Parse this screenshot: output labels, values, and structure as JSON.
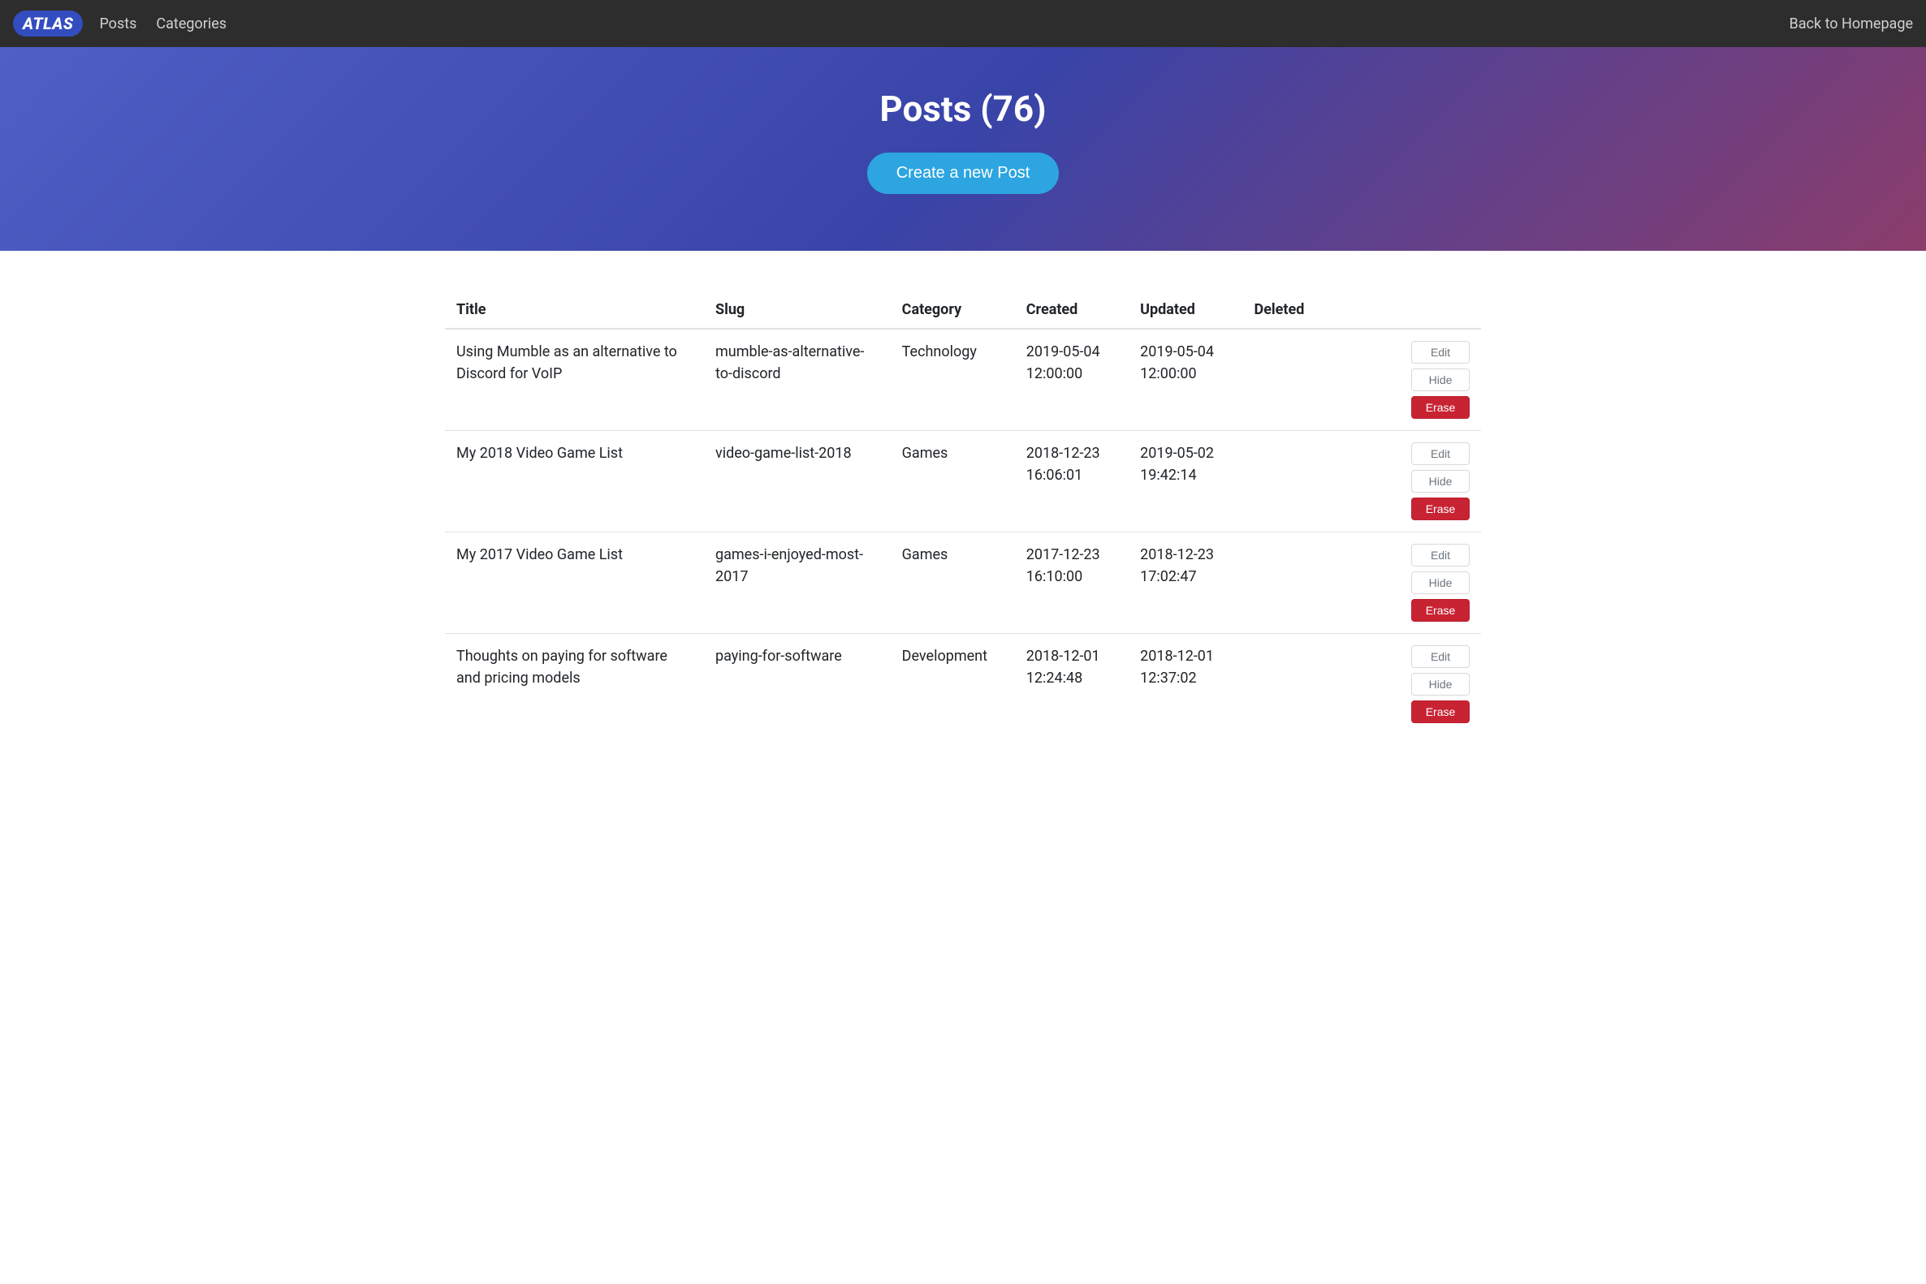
{
  "navbar": {
    "brand": "ATLAS",
    "links": [
      {
        "label": "Posts"
      },
      {
        "label": "Categories"
      }
    ],
    "back_link": "Back to Homepage"
  },
  "hero": {
    "title": "Posts (76)",
    "create_button": "Create a new Post"
  },
  "table": {
    "headers": {
      "title": "Title",
      "slug": "Slug",
      "category": "Category",
      "created": "Created",
      "updated": "Updated",
      "deleted": "Deleted"
    },
    "actions": {
      "edit": "Edit",
      "hide": "Hide",
      "erase": "Erase"
    },
    "rows": [
      {
        "title": "Using Mumble as an alternative to Discord for VoIP",
        "slug": "mumble-as-alternative-to-discord",
        "category": "Technology",
        "created": "2019-05-04 12:00:00",
        "updated": "2019-05-04 12:00:00",
        "deleted": ""
      },
      {
        "title": "My 2018 Video Game List",
        "slug": "video-game-list-2018",
        "category": "Games",
        "created": "2018-12-23 16:06:01",
        "updated": "2019-05-02 19:42:14",
        "deleted": ""
      },
      {
        "title": "My 2017 Video Game List",
        "slug": "games-i-enjoyed-most-2017",
        "category": "Games",
        "created": "2017-12-23 16:10:00",
        "updated": "2018-12-23 17:02:47",
        "deleted": ""
      },
      {
        "title": "Thoughts on paying for software and pricing models",
        "slug": "paying-for-software",
        "category": "Development",
        "created": "2018-12-01 12:24:48",
        "updated": "2018-12-01 12:37:02",
        "deleted": ""
      }
    ]
  }
}
